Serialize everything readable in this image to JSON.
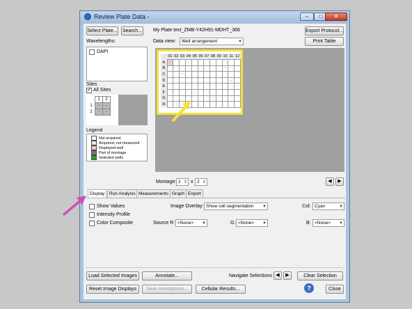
{
  "window": {
    "title": "Review Plate Data -"
  },
  "toolbar": {
    "select_plate": "Select Plate...",
    "search": "Search...",
    "plate_name": "My Plate test_ZMB-Y42H91-MDHT_366",
    "export_protocol": "Export Protocol...",
    "print_table": "Print Table",
    "data_view_label": "Data view:",
    "data_view_value": "Well arrangement"
  },
  "wavelengths": {
    "label": "Wavelengths:",
    "items": [
      "DAPI"
    ]
  },
  "sites": {
    "label": "Sites",
    "all_sites": "All Sites",
    "cols": [
      "1",
      "2"
    ],
    "rows": [
      {
        "h": "1",
        "c": [
          "-",
          "-"
        ]
      },
      {
        "h": "2",
        "c": [
          "-",
          "-"
        ]
      }
    ]
  },
  "legend": {
    "label": "Legend",
    "items": [
      {
        "text": "Not acquired",
        "color": "#ffffff"
      },
      {
        "text": "Acquired, not measured",
        "color": "#e6e6e6"
      },
      {
        "text": "Displayed well",
        "color": "#f4c6c6"
      },
      {
        "text": "Part of montage",
        "color": "#7a7a7a"
      },
      {
        "text": "Selected wells",
        "color": "#2fa02f"
      }
    ]
  },
  "plate": {
    "cols": [
      "01",
      "02",
      "03",
      "04",
      "05",
      "06",
      "07",
      "08",
      "09",
      "10",
      "11",
      "12"
    ],
    "rows": [
      "A",
      "B",
      "C",
      "D",
      "E",
      "F",
      "G",
      "H"
    ],
    "marks": [
      [
        "",
        "",
        "",
        "-",
        "",
        "",
        "",
        "",
        "",
        "",
        "",
        ""
      ],
      [
        "",
        "",
        "",
        "",
        "",
        "",
        "",
        "",
        "",
        "-",
        "",
        ""
      ],
      [
        "",
        "",
        "-",
        "",
        "",
        "",
        "",
        "",
        "",
        "",
        "",
        ""
      ],
      [
        "",
        "",
        "",
        "",
        "",
        "",
        "",
        "",
        "",
        "",
        "-",
        ""
      ],
      [
        "",
        "",
        "",
        "",
        "",
        "",
        "",
        "",
        "",
        "",
        "",
        "-"
      ],
      [
        "",
        "",
        "",
        "",
        "-",
        "",
        "",
        "",
        "",
        "",
        "",
        ""
      ],
      [
        "",
        "",
        "",
        "",
        "",
        "",
        "",
        "-",
        "",
        "",
        "",
        ""
      ],
      [
        "",
        "-",
        "",
        "",
        "",
        "",
        "",
        "",
        "",
        "",
        "",
        ""
      ]
    ]
  },
  "montage": {
    "label": "Montage:",
    "x_label": "x",
    "rows": "2",
    "cols": "2"
  },
  "tabs": [
    "Display",
    "Run Analysis",
    "Measurements",
    "Graph",
    "Export"
  ],
  "display": {
    "show_values": "Show Values",
    "intensity_profile": "Intensity Profile",
    "color_composite": "Color Composite",
    "image_overlay_label": "Image Overlay:",
    "image_overlay_value": "Show cell segmentation",
    "col_label": "Col:",
    "col_value": "Cyan",
    "source_r_label": "Source R:",
    "source_r_value": "<None>",
    "g_label": "G:",
    "g_value": "<None>",
    "b_label": "B:",
    "b_value": "<None>"
  },
  "footer": {
    "load_selected": "Load Selected Images",
    "annotate": "Annotate...",
    "navigate_label": "Navigate Selections",
    "clear_selection": "Clear Selection",
    "reset_displays": "Reset Image Displays",
    "save_annotations": "Save Annotations...",
    "cellular_results": "Cellular Results...",
    "close": "Close",
    "help_icon_glyph": "?"
  },
  "colors": {
    "highlight": "#f2e23a",
    "arrow_pink": "#d04fb8",
    "window_frame": "#aac4de"
  }
}
